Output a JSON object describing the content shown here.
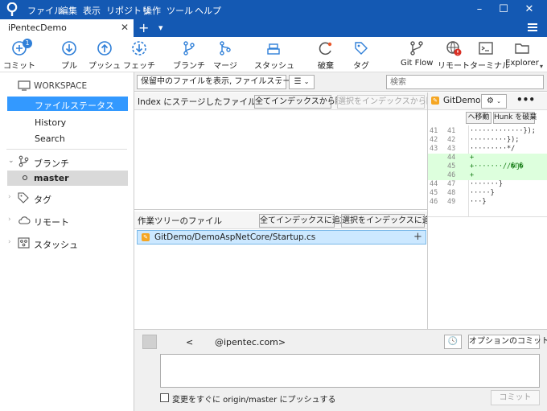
{
  "menu": [
    "ファイル",
    "編集",
    "表示",
    "リポジトリ",
    "操作",
    "ツール",
    "ヘルプ"
  ],
  "tab": {
    "title": "iPentecDemo",
    "close": "✕",
    "add": "+",
    "dropdown": "▾"
  },
  "toolbar": {
    "commit": {
      "label": "コミット",
      "badge": "1"
    },
    "pull": "プル",
    "push": "プッシュ",
    "fetch": "フェッチ",
    "branch": "ブランチ",
    "merge": "マージ",
    "stash": "スタッシュ",
    "discard": "破棄",
    "tag": "タグ",
    "gitflow": "Git Flow",
    "remote": "リモート",
    "terminal": "ターミナル",
    "explorer": "Explorer"
  },
  "sidebar": {
    "workspace": "WORKSPACE",
    "items": [
      "ファイルステータス",
      "History",
      "Search"
    ],
    "branches": "ブランチ",
    "current_branch": "master",
    "tags": "タグ",
    "remotes": "リモート",
    "stashes": "スタッシュ"
  },
  "filterbar": {
    "filter": "保留中のファイルを表示, ファイルステータス順",
    "search_placeholder": "検索"
  },
  "staged": {
    "header": "Index にステージしたファイル",
    "unstage_all": "全てインデックスから除く",
    "unstage_selected": "選択をインデックスから除く"
  },
  "working": {
    "header": "作業ツリーのファイル",
    "add_all": "全てインデックスに追加",
    "add_selected": "選択をインデックスに追加",
    "file": "GitDemo/DemoAspNetCore/Startup.cs"
  },
  "diff": {
    "title": "GitDemo...",
    "move": "ヘ移動",
    "discard_hunk": "Hunk を破棄",
    "lines": [
      {
        "n1": "41",
        "n2": "41",
        "code": "·············});",
        "type": "ctx"
      },
      {
        "n1": "42",
        "n2": "42",
        "code": "·········});",
        "type": "ctx"
      },
      {
        "n1": "43",
        "n2": "43",
        "code": "·········*/",
        "type": "ctx"
      },
      {
        "n1": "",
        "n2": "44",
        "code": "+",
        "type": "add"
      },
      {
        "n1": "",
        "n2": "45",
        "code": "+·······//�Ŋ�",
        "type": "add"
      },
      {
        "n1": "",
        "n2": "46",
        "code": "+",
        "type": "add"
      },
      {
        "n1": "44",
        "n2": "47",
        "code": "·······}",
        "type": "ctx"
      },
      {
        "n1": "45",
        "n2": "48",
        "code": "·····}",
        "type": "ctx"
      },
      {
        "n1": "46",
        "n2": "49",
        "code": "···}",
        "type": "ctx"
      }
    ]
  },
  "commit": {
    "author_name": "<",
    "author_email": "@ipentec.com>",
    "options": "オプションのコミット",
    "push_label": "変更をすぐに origin/master にプッシュする",
    "commit_button": "コミット"
  },
  "colors": {
    "accent": "#1459b3",
    "selected": "#3399ff",
    "add_bg": "#ddffdd"
  }
}
